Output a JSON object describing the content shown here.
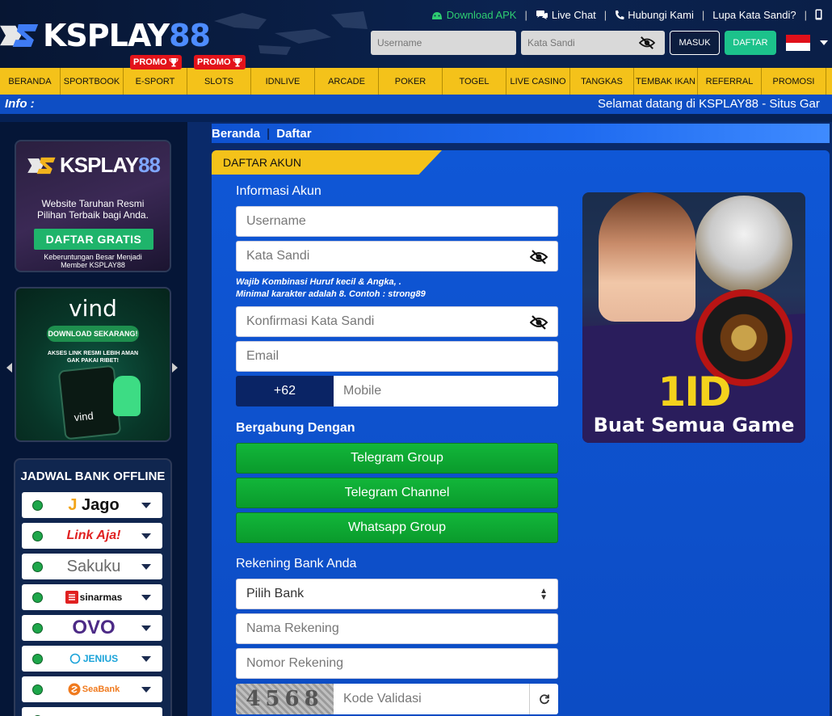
{
  "header": {
    "logo_text": "KSPLAY",
    "logo_num": "88",
    "top_links": [
      {
        "label": "Download APK",
        "icon": "android-icon"
      },
      {
        "label": "Live Chat",
        "icon": "chat-icon"
      },
      {
        "label": "Hubungi Kami",
        "icon": "phone-icon"
      },
      {
        "label": "Lupa Kata Sandi?",
        "icon": ""
      }
    ],
    "login": {
      "username_placeholder": "Username",
      "password_placeholder": "Kata Sandi",
      "masuk_label": "MASUK",
      "daftar_label": "DAFTAR"
    },
    "language_flag": "id-flag"
  },
  "nav": {
    "items": [
      "BERANDA",
      "SPORTBOOK",
      "E-SPORT",
      "SLOTS",
      "IDNLIVE",
      "ARCADE",
      "POKER",
      "TOGEL",
      "LIVE CASINO",
      "TANGKAS",
      "TEMBAK IKAN",
      "REFERRAL",
      "PROMOSI"
    ],
    "promo_badge": "PROMO"
  },
  "info": {
    "label": "Info :",
    "message": "Selamat datang di KSPLAY88 - Situs Gar"
  },
  "sidebar": {
    "banner1": {
      "logo_text": "KSPLAY",
      "logo_num": "88",
      "tagline_1": "Website Taruhan Resmi",
      "tagline_2": "Pilihan Terbaik bagi Anda.",
      "button": "DAFTAR GRATIS",
      "foot_1": "Keberuntungan Besar Menjadi",
      "foot_2": "Member KSPLAY88"
    },
    "banner2": {
      "logo": "vind",
      "download": "DOWNLOAD SEKARANG!",
      "text_1": "AKSES LINK RESMI LEBIH AMAN",
      "text_2": "GAK PAKAI RIBET!",
      "phone_text": "vind"
    },
    "bank": {
      "title": "JADWAL BANK OFFLINE",
      "items": [
        {
          "name": "Jago",
          "color": "#111111"
        },
        {
          "name": "Link Aja!",
          "color": "#e02020"
        },
        {
          "name": "Sakuku",
          "color": "#6a6a6a"
        },
        {
          "name": "sinarmas",
          "color": "#111111"
        },
        {
          "name": "OVO",
          "color": "#4c2a86"
        },
        {
          "name": "JENIUS",
          "color": "#1aa3d9"
        },
        {
          "name": "SeaBank",
          "color": "#f07a1e"
        }
      ],
      "status_color": "#1ea64a"
    }
  },
  "breadcrumb": {
    "home": "Beranda",
    "sep": "|",
    "current": "Daftar"
  },
  "form": {
    "title": "DAFTAR AKUN",
    "section_account": "Informasi Akun",
    "username": "Username",
    "password": "Kata Sandi",
    "hint_1": "Wajib Kombinasi Huruf kecil & Angka, .",
    "hint_2": "Minimal karakter adalah 8. Contoh : strong89",
    "confirm_password": "Konfirmasi Kata Sandi",
    "email": "Email",
    "country_code": "+62",
    "mobile": "Mobile",
    "section_join": "Bergabung Dengan",
    "social": [
      "Telegram Group",
      "Telegram Channel",
      "Whatsapp Group"
    ],
    "section_bank": "Rekening Bank Anda",
    "bank_select": "Pilih Bank",
    "account_name": "Nama Rekening",
    "account_number": "Nomor Rekening",
    "captcha_code": "4568",
    "validation": "Kode Validasi"
  },
  "promo": {
    "big": "1ID",
    "sub": "Buat Semua Game"
  },
  "colors": {
    "accent_yellow": "#f4c21a",
    "primary_blue": "#0f57d6",
    "green_button": "#12b63a",
    "daftar_green": "#1cc28b"
  }
}
